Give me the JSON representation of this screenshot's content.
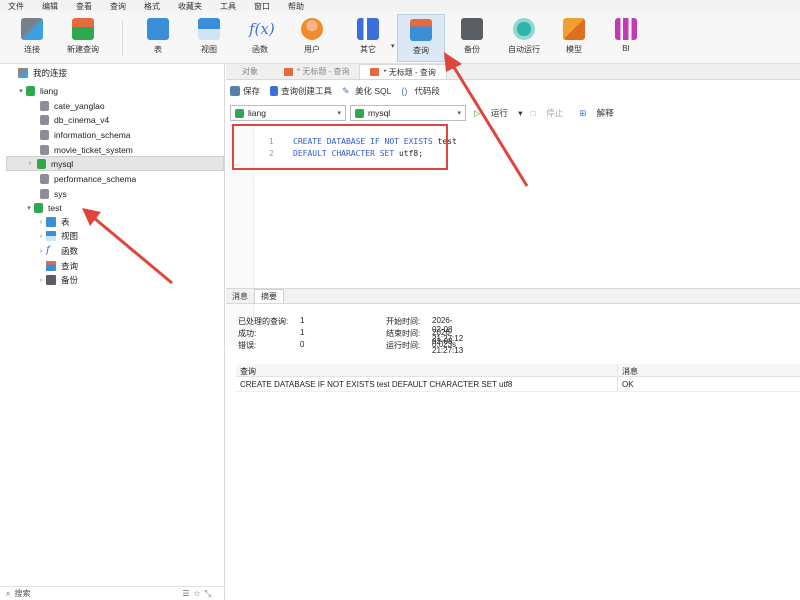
{
  "menu": [
    "文件",
    "编辑",
    "查看",
    "查询",
    "格式",
    "收藏夹",
    "工具",
    "窗口",
    "帮助"
  ],
  "toolbar": {
    "connect": "连接",
    "new_query": "新建查询",
    "table": "表",
    "view": "视图",
    "function": "函数",
    "user": "用户",
    "other": "其它",
    "query": "查询",
    "backup": "备份",
    "auto_run": "自动运行",
    "model": "模型",
    "bi": "BI"
  },
  "sidebar": {
    "root_label": "我的连接",
    "connection": "liang",
    "databases": [
      "cate_yanglao",
      "db_cinema_v4",
      "information_schema",
      "movie_ticket_system",
      "mysql",
      "performance_schema",
      "sys",
      "test"
    ],
    "test_children": [
      "表",
      "视图",
      "函数",
      "查询",
      "备份"
    ],
    "search_placeholder": "搜索"
  },
  "tabs": {
    "objects": "对象",
    "tab1": "* 无标题 - 查询",
    "tab2": "* 无标题 - 查询"
  },
  "query_toolbar": {
    "save": "保存",
    "builder": "查询创建工具",
    "beautify": "美化 SQL",
    "snippet": "代码段"
  },
  "selectors": {
    "connection": "liang",
    "database": "mysql",
    "run": "运行",
    "stop": "停止",
    "explain": "解释"
  },
  "editor": {
    "line1_no": "1",
    "line1_kw": "CREATE DATABASE IF NOT EXISTS",
    "line1_rest": " test",
    "line2_no": "2",
    "line2_kw": "DEFAULT CHARACTER SET",
    "line2_rest": " utf8;"
  },
  "result_tabs": {
    "message": "消息",
    "summary": "摘要"
  },
  "summary": {
    "processed_label": "已处理的查询:",
    "processed_value": "1",
    "success_label": "成功:",
    "success_value": "1",
    "error_label": "错误:",
    "error_value": "0",
    "start_label": "开始时间:",
    "start_value": "2026-02-08 21:27:12",
    "end_label": "结束时间:",
    "end_value": "2026-02-08 21:27:13",
    "runtime_label": "运行时间:",
    "runtime_value": "0.023s"
  },
  "result_table": {
    "headers": [
      "查询",
      "消息"
    ],
    "rows": [
      [
        "CREATE DATABASE IF NOT EXISTS test DEFAULT CHARACTER SET utf8",
        "OK"
      ]
    ]
  },
  "colors": {
    "annotation_red": "#e0453b",
    "db_green": "#2fa84f",
    "keyword_blue": "#2f5bd6"
  }
}
